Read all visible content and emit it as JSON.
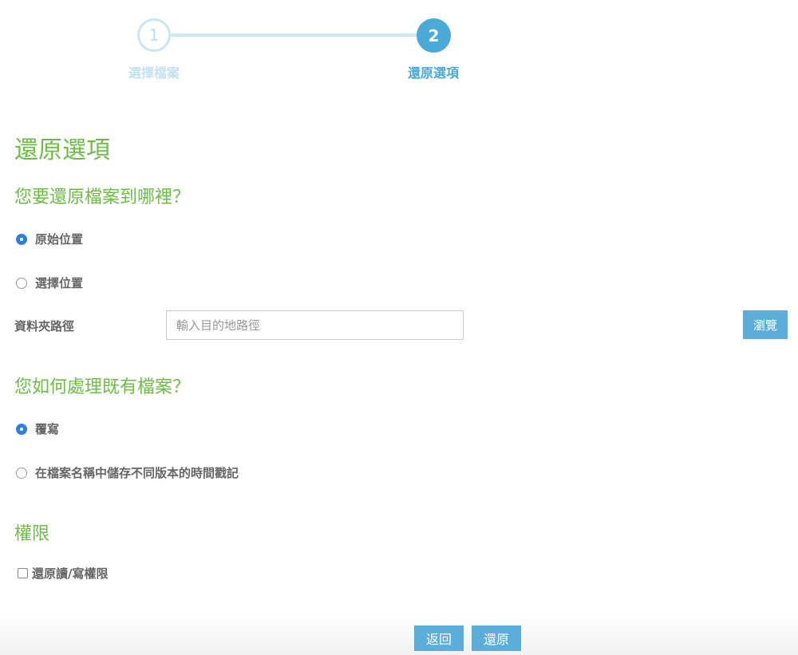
{
  "stepper": {
    "steps": [
      {
        "number": "1",
        "label": "選擇檔案",
        "state": "inactive"
      },
      {
        "number": "2",
        "label": "還原選項",
        "state": "active"
      }
    ]
  },
  "page_title": "還原選項",
  "destination": {
    "question": "您要還原檔案到哪裡？",
    "options": [
      {
        "label": "原始位置",
        "checked": true
      },
      {
        "label": "選擇位置",
        "checked": false
      }
    ],
    "folder_path_label": "資料夾路徑",
    "folder_path_value": "",
    "folder_path_placeholder": "輸入目的地路徑",
    "browse_label": "瀏覽"
  },
  "existing_files": {
    "question": "您如何處理既有檔案？",
    "options": [
      {
        "label": "覆寫",
        "checked": true
      },
      {
        "label": "在檔案名稱中儲存不同版本的時間戳記",
        "checked": false
      }
    ]
  },
  "permissions": {
    "heading": "權限",
    "checkbox_label": "還原讀/寫權限",
    "checked": false
  },
  "footer": {
    "back_label": "返回",
    "restore_label": "還原"
  },
  "colors": {
    "accent_blue": "#4ba9d8",
    "button_blue": "#5aaed9",
    "heading_green": "#6cbd45",
    "radio_checked": "#2f7fe0",
    "inactive_step": "#c9e6f3"
  }
}
